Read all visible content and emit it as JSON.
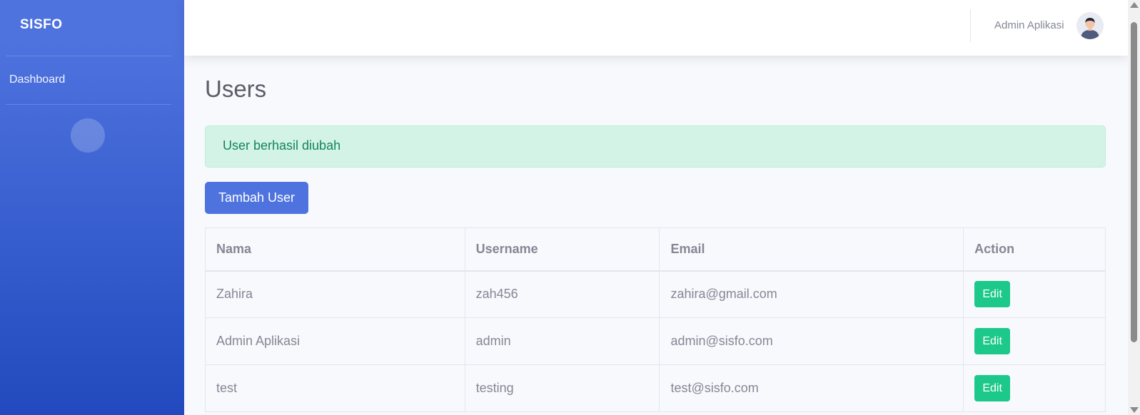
{
  "sidebar": {
    "brand": "SISFO",
    "items": [
      {
        "label": "Dashboard"
      }
    ],
    "toggle_glyph": "",
    "bg_gradient": [
      "#4e73df",
      "#224abe"
    ]
  },
  "topbar": {
    "user_name": "Admin Aplikasi",
    "avatar_icon": "user-avatar-icon"
  },
  "main": {
    "title": "Users",
    "alert": "User berhasil diubah",
    "add_button": "Tambah User",
    "table": {
      "headers": [
        "Nama",
        "Username",
        "Email",
        "Action"
      ],
      "rows": [
        {
          "nama": "Zahira",
          "username": "zah456",
          "email": "zahira@gmail.com",
          "action": "Edit"
        },
        {
          "nama": "Admin Aplikasi",
          "username": "admin",
          "email": "admin@sisfo.com",
          "action": "Edit"
        },
        {
          "nama": "test",
          "username": "testing",
          "email": "test@sisfo.com",
          "action": "Edit"
        }
      ]
    }
  },
  "colors": {
    "primary": "#4e73df",
    "success": "#1cc88a",
    "alert_bg": "#d3f3e6",
    "alert_text": "#13855c",
    "text_muted": "#858796"
  }
}
